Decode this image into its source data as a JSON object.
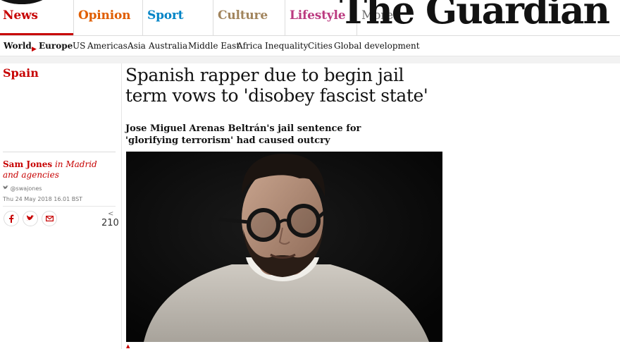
{
  "nav": {
    "pillars": [
      {
        "label": "News",
        "color": "#c70000"
      },
      {
        "label": "Opinion",
        "color": "#e05e00"
      },
      {
        "label": "Sport",
        "color": "#0084c6"
      },
      {
        "label": "Culture",
        "color": "#a1845c"
      },
      {
        "label": "Lifestyle",
        "color": "#bb3b80"
      }
    ],
    "more": "More",
    "more_icon": "chevron-down-icon"
  },
  "masthead": "The Guardian",
  "subnav": {
    "world": "World",
    "europe": "Europe",
    "items": [
      "US",
      "Americas",
      "Asia",
      "Australia",
      "Middle East",
      "Africa",
      "Inequality",
      "Cities",
      "Global development"
    ]
  },
  "article": {
    "section": "Spain",
    "headline": "Spanish rapper due to begin jail term vows to 'disobey fascist state'",
    "standfirst": "Jose Miguel Arenas Beltrán's jail sentence for 'glorifying terrorism' had caused outcry",
    "byline": {
      "author": "Sam Jones",
      "location": "in Madrid and agencies",
      "twitter": "@swajones",
      "twitter_icon": "twitter-icon",
      "timestamp": "Thu 24 May 2018 16.01 BST"
    },
    "share": {
      "icons": [
        "facebook-icon",
        "twitter-icon",
        "email-icon"
      ],
      "count": "210"
    },
    "image_caption_icon": "triangle-icon"
  }
}
